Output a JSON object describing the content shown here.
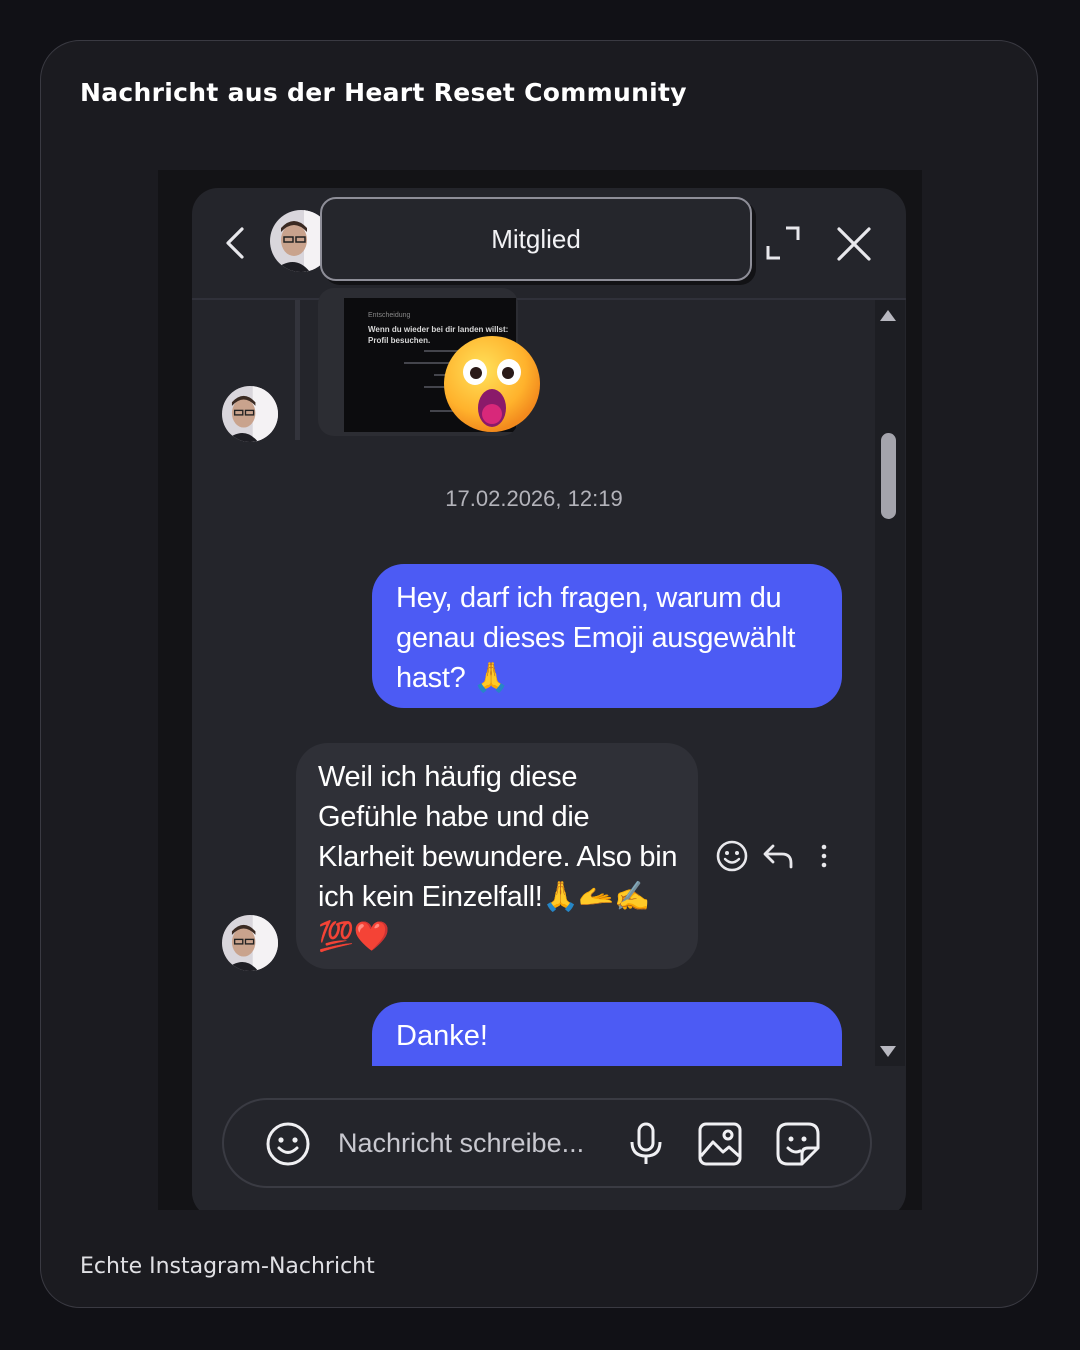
{
  "card": {
    "title": "Nachricht aus der Heart Reset Community",
    "caption": "Echte Instagram-Nachricht"
  },
  "chat": {
    "header": {
      "name": "Mitglied",
      "icons": [
        "chevron-left-icon",
        "avatar",
        "expand-icon",
        "close-icon"
      ]
    },
    "shared_post": {
      "small_text": "Entscheidung",
      "text": "Wenn du wieder bei dir landen willst: Profil besuchen.",
      "reaction": "😮"
    },
    "timestamp": "17.02.2026, 12:19",
    "messages": [
      {
        "direction": "outgoing",
        "text": "Hey, darf ich fragen, warum du genau dieses Emoji ausgewählt hast? 🙏"
      },
      {
        "direction": "incoming",
        "text": "Weil ich häufig diese Gefühle habe und die Klarheit  bewundere. Also bin ich kein Einzelfall!🙏🫴✍️💯❤️"
      },
      {
        "direction": "outgoing",
        "text": "Danke!"
      }
    ],
    "message_actions": [
      "smiley-icon",
      "reply-icon",
      "more-vertical-icon"
    ],
    "composer": {
      "placeholder": "Nachricht schreibe...",
      "icons": [
        "smiley-icon",
        "microphone-icon",
        "image-icon",
        "sticker-icon"
      ]
    },
    "colors": {
      "outgoing_bubble": "#4c5bf4",
      "incoming_bubble": "#2f3037",
      "panel": "#24252b",
      "page_bg": "#111116"
    }
  }
}
